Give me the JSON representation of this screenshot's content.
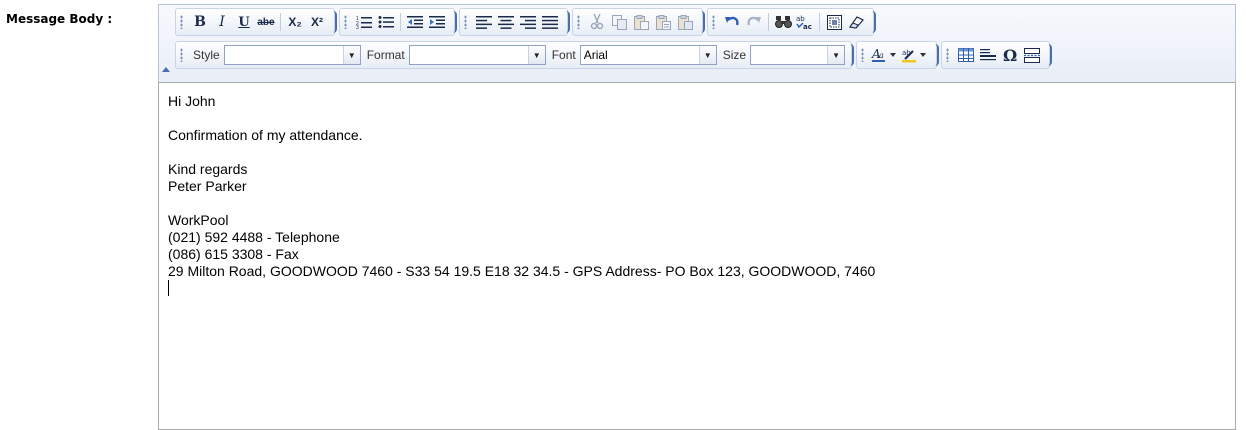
{
  "form": {
    "field_label": "Message Body :"
  },
  "toolbar": {
    "row1": {
      "format": [
        "B",
        "I",
        "U",
        "abe"
      ],
      "script": [
        "X₂",
        "X²"
      ],
      "lists": [
        "ordered-list-icon",
        "unordered-list-icon",
        "outdent-icon",
        "indent-icon"
      ],
      "align": [
        "align-left-icon",
        "align-center-icon",
        "align-right-icon",
        "justify-icon"
      ],
      "clipboard": [
        "cut-icon",
        "copy-icon",
        "paste-icon",
        "paste-text-icon",
        "paste-word-icon"
      ],
      "history": [
        "undo-icon",
        "redo-icon",
        "find-icon",
        "spellcheck-icon",
        "source-icon",
        "eraser-icon"
      ]
    },
    "row2": {
      "style_label": "Style",
      "style_value": "",
      "format_label": "Format",
      "format_value": "",
      "font_label": "Font",
      "font_value": "Arial",
      "size_label": "Size",
      "size_value": ""
    }
  },
  "body": {
    "lines": [
      "Hi John",
      "",
      "Confirmation of my attendance.",
      "",
      "Kind regards",
      "Peter Parker",
      "",
      "WorkPool",
      "(021) 592 4488 - Telephone",
      "(086) 615 3308 - Fax",
      "29 Milton Road, GOODWOOD 7460 - S33 54 19.5 E18 32 34.5 - GPS Address- PO Box 123, GOODWOOD, 7460"
    ]
  },
  "colors": {
    "toolbar_bg": "#e9eef7",
    "toolbar_border": "#b7c4dc",
    "accent": "#4a6ea9"
  }
}
